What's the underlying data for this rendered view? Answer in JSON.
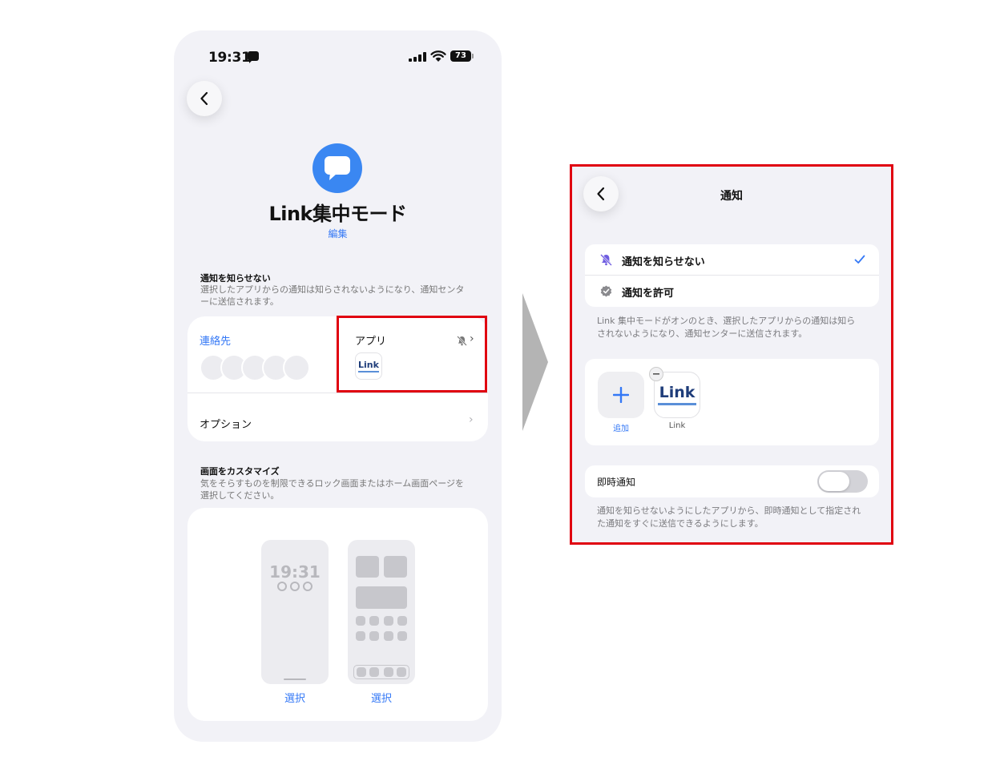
{
  "status_bar": {
    "time": "19:31",
    "battery": "73"
  },
  "focus": {
    "title": "Link集中モード",
    "edit_label": "編集"
  },
  "silence_section": {
    "heading": "通知を知らせない",
    "description": "選択したアプリからの通知は知らされないようになり、通知センターに送信されます。"
  },
  "people_apps_card": {
    "contacts_label": "連絡先",
    "apps_label": "アプリ",
    "app_logo_text": "Link",
    "options_label": "オプション"
  },
  "customize_section": {
    "heading": "画面をカスタマイズ",
    "description": "気をそらすものを制限できるロック画面またはホーム画面ページを選択してください。",
    "lock_preview_time": "19:31",
    "select_label_left": "選択",
    "select_label_right": "選択"
  },
  "notifications_screen": {
    "title": "通知",
    "options": [
      {
        "label": "通知を知らせない",
        "selected": true,
        "icon": "bell-slash-icon"
      },
      {
        "label": "通知を許可",
        "selected": false,
        "icon": "checkmark-seal-icon"
      }
    ],
    "mode_description": "Link 集中モードがオンのとき、選択したアプリからの通知は知らされないようになり、通知センターに送信されます。",
    "apps": {
      "add_label": "追加",
      "app_logo_text": "Link",
      "app_name": "Link"
    },
    "time_sensitive": {
      "label": "即時通知",
      "enabled": false,
      "description": "通知を知らせないようにしたアプリから、即時通知として指定された通知をすぐに送信できるようにします。"
    }
  },
  "colors": {
    "accent": "#3478f6",
    "focus_icon": "#3a87f2",
    "highlight": "#e00010",
    "icon_purple": "#6e5ce0"
  }
}
